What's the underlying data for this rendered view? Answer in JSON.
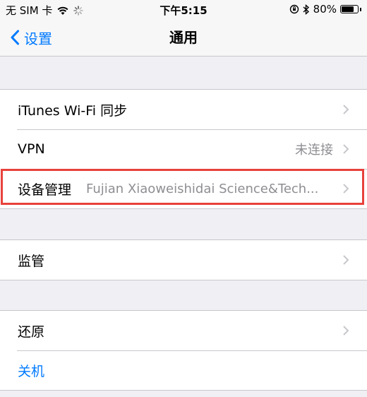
{
  "status_bar": {
    "carrier": "无 SIM 卡",
    "time": "下午5:15",
    "battery_text": "80%",
    "battery_level": 0.8
  },
  "nav": {
    "back_label": "设置",
    "title": "通用"
  },
  "groups": [
    {
      "rows": [
        {
          "label": "iTunes Wi-Fi 同步",
          "detail": ""
        },
        {
          "label": "VPN",
          "detail": "未连接"
        },
        {
          "label": "设备管理",
          "detail": "Fujian Xiaoweishidai Science&Tech..."
        }
      ]
    },
    {
      "rows": [
        {
          "label": "监管",
          "detail": ""
        }
      ]
    },
    {
      "rows": [
        {
          "label": "还原",
          "detail": ""
        },
        {
          "label": "关机",
          "detail": ""
        }
      ]
    }
  ],
  "colors": {
    "accent": "#007aff",
    "highlight": "#e8413b",
    "background": "#efeff4"
  }
}
